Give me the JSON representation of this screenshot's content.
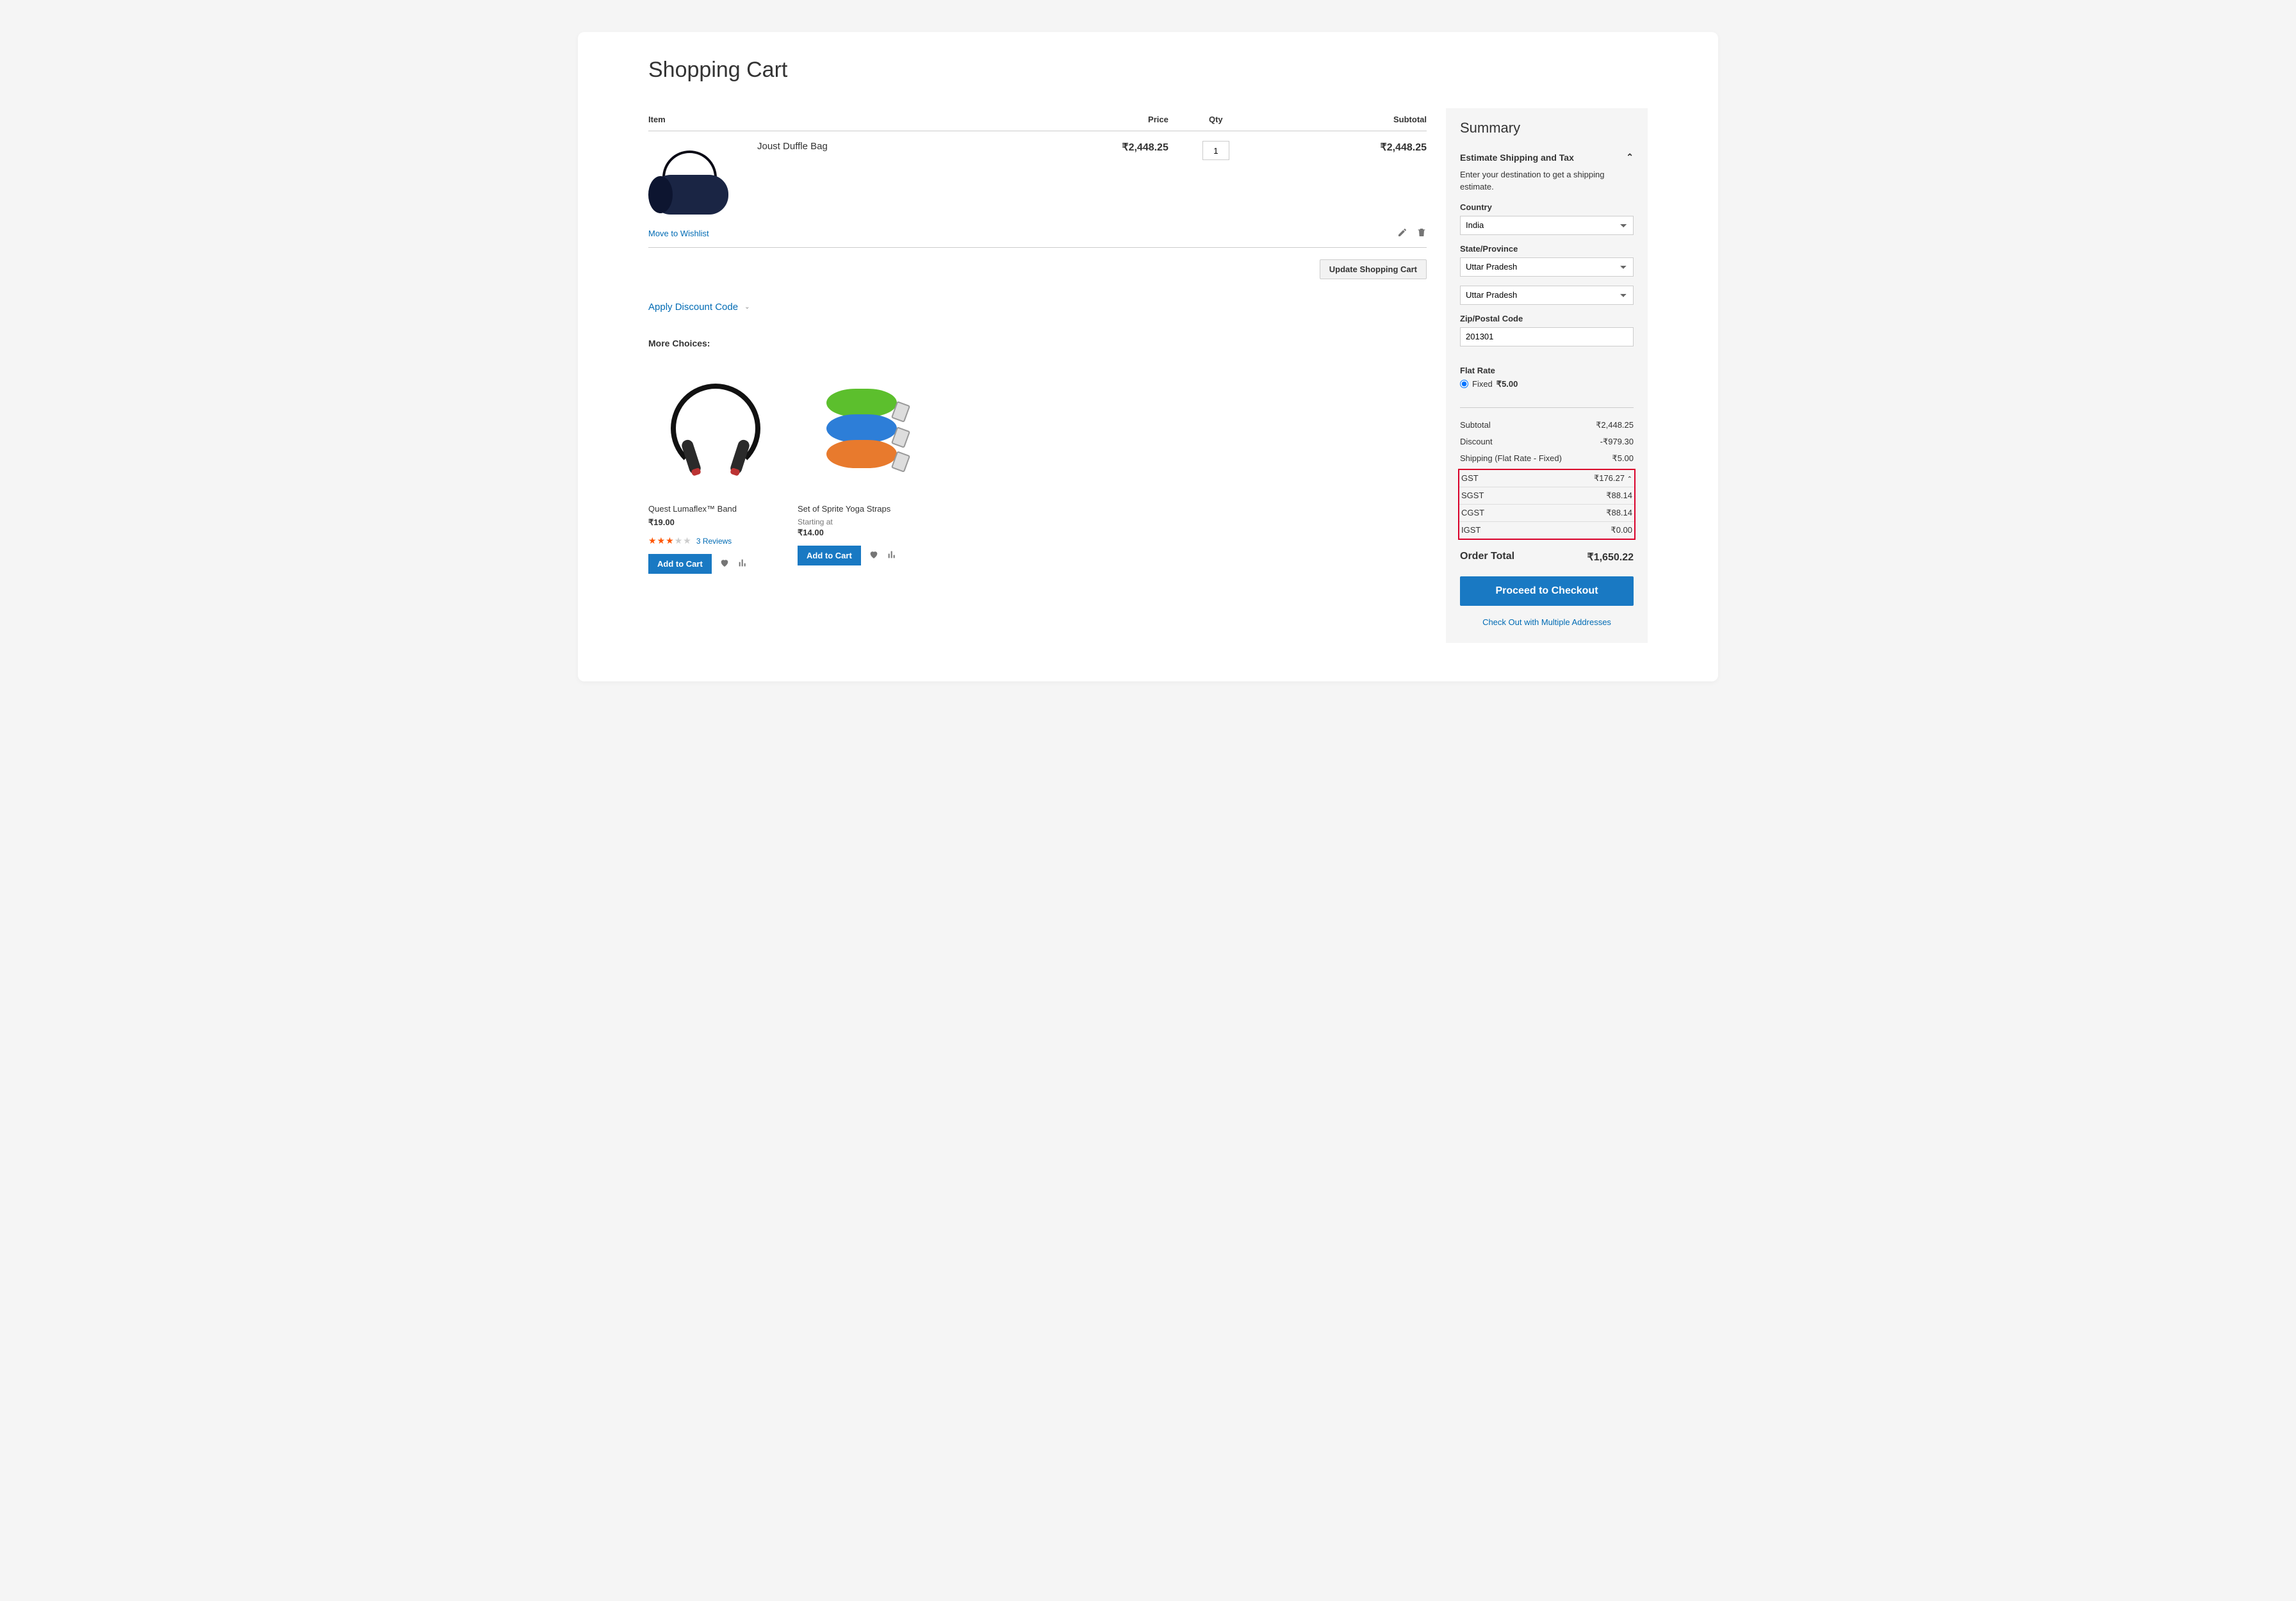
{
  "page_title": "Shopping Cart",
  "cart": {
    "headers": {
      "item": "Item",
      "price": "Price",
      "qty": "Qty",
      "subtotal": "Subtotal"
    },
    "items": [
      {
        "name": "Joust Duffle Bag",
        "price": "₹2,448.25",
        "qty": "1",
        "subtotal": "₹2,448.25"
      }
    ],
    "move_wishlist": "Move to Wishlist",
    "update_button": "Update Shopping Cart",
    "discount_link": "Apply Discount Code"
  },
  "more_choices": {
    "title": "More Choices:",
    "products": [
      {
        "name": "Quest Lumaflex™ Band",
        "price": "₹19.00",
        "reviews": "3 Reviews",
        "add_label": "Add to Cart"
      },
      {
        "name": "Set of Sprite Yoga Straps",
        "starting_at": "Starting at",
        "price": "₹14.00",
        "add_label": "Add to Cart"
      }
    ]
  },
  "summary": {
    "title": "Summary",
    "estimate_title": "Estimate Shipping and Tax",
    "estimate_desc": "Enter your destination to get a shipping estimate.",
    "country_label": "Country",
    "country_value": "India",
    "state_label": "State/Province",
    "state_value": "Uttar Pradesh",
    "state_value2": "Uttar Pradesh",
    "zip_label": "Zip/Postal Code",
    "zip_value": "201301",
    "flat_rate_label": "Flat Rate",
    "fixed_label": "Fixed",
    "fixed_price": "₹5.00",
    "lines": {
      "subtotal_label": "Subtotal",
      "subtotal_value": "₹2,448.25",
      "discount_label": "Discount",
      "discount_value": "-₹979.30",
      "shipping_label": "Shipping (Flat Rate - Fixed)",
      "shipping_value": "₹5.00",
      "gst_label": "GST",
      "gst_value": "₹176.27",
      "sgst_label": "SGST",
      "sgst_value": "₹88.14",
      "cgst_label": "CGST",
      "cgst_value": "₹88.14",
      "igst_label": "IGST",
      "igst_value": "₹0.00"
    },
    "order_total_label": "Order Total",
    "order_total_value": "₹1,650.22",
    "checkout_button": "Proceed to Checkout",
    "multi_address": "Check Out with Multiple Addresses"
  }
}
